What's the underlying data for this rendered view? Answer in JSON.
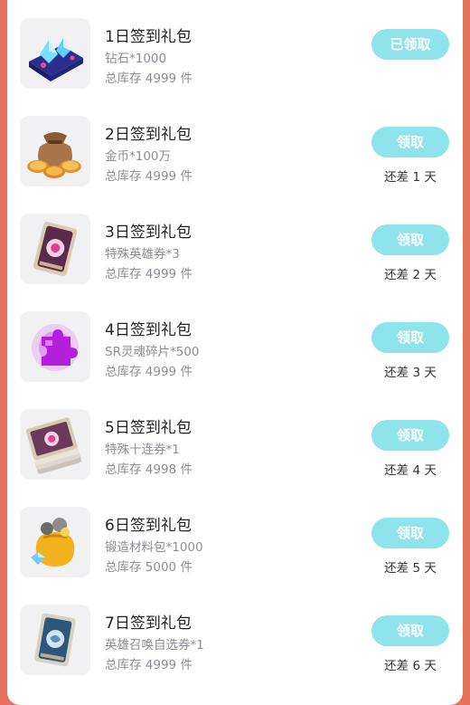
{
  "items": [
    {
      "title": "1日签到礼包",
      "desc": "钻石*1000",
      "stock": "总库存 4999 件",
      "button": "已领取",
      "remain": "",
      "icon": "diamond-crystal-icon"
    },
    {
      "title": "2日签到礼包",
      "desc": "金币*100万",
      "stock": "总库存 4999 件",
      "button": "领取",
      "remain": "还差 1 天",
      "icon": "gold-coin-bag-icon"
    },
    {
      "title": "3日签到礼包",
      "desc": "特殊英雄券*3",
      "stock": "总库存 4999 件",
      "button": "领取",
      "remain": "还差 2 天",
      "icon": "hero-ticket-card-icon"
    },
    {
      "title": "4日签到礼包",
      "desc": "SR灵魂碎片*500",
      "stock": "总库存 4999 件",
      "button": "领取",
      "remain": "还差 3 天",
      "icon": "soul-fragment-puzzle-icon"
    },
    {
      "title": "5日签到礼包",
      "desc": "特殊十连券*1",
      "stock": "总库存 4998 件",
      "button": "领取",
      "remain": "还差 4 天",
      "icon": "ten-pull-ticket-stack-icon"
    },
    {
      "title": "6日签到礼包",
      "desc": "锻造材料包*1000",
      "stock": "总库存 5000 件",
      "button": "领取",
      "remain": "还差 5 天",
      "icon": "forge-material-bag-icon"
    },
    {
      "title": "7日签到礼包",
      "desc": "英雄召唤自选券*1",
      "stock": "总库存 4999 件",
      "button": "领取",
      "remain": "还差 6 天",
      "icon": "hero-summon-ticket-icon"
    }
  ],
  "colors": {
    "background": "#e4725c",
    "button": "#8fe3ea"
  }
}
